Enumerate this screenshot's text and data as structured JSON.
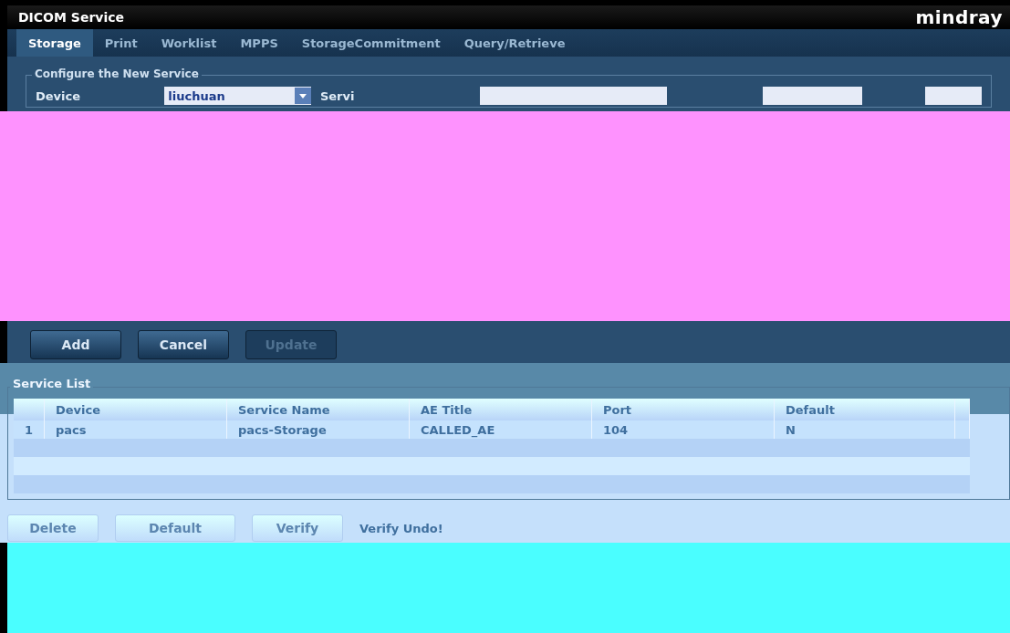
{
  "window": {
    "title": "DICOM Service",
    "brand": "mindray"
  },
  "tabs": [
    {
      "label": "Storage",
      "selected": true
    },
    {
      "label": "Print",
      "selected": false
    },
    {
      "label": "Worklist",
      "selected": false
    },
    {
      "label": "MPPS",
      "selected": false
    },
    {
      "label": "StorageCommitment",
      "selected": false
    },
    {
      "label": "Query/Retrieve",
      "selected": false
    }
  ],
  "configure": {
    "title": "Configure the New Service",
    "device_label": "Device",
    "device_value": "liuchuan",
    "service_label": "Servi"
  },
  "actions": [
    {
      "label": "Add",
      "disabled": false
    },
    {
      "label": "Cancel",
      "disabled": false
    },
    {
      "label": "Update",
      "disabled": true
    }
  ],
  "service_list": {
    "title": "Service List",
    "columns": [
      "Device",
      "Service Name",
      "AE Title",
      "Port",
      "Default"
    ],
    "rows": [
      {
        "index": "1",
        "cells": [
          "pacs",
          "pacs-Storage",
          "CALLED_AE",
          "104",
          "N"
        ]
      }
    ]
  },
  "bottom_buttons": [
    {
      "label": "Delete",
      "disabled": true
    },
    {
      "label": "Default",
      "disabled": true
    },
    {
      "label": "Verify",
      "disabled": true
    }
  ],
  "status": "Verify Undo!"
}
